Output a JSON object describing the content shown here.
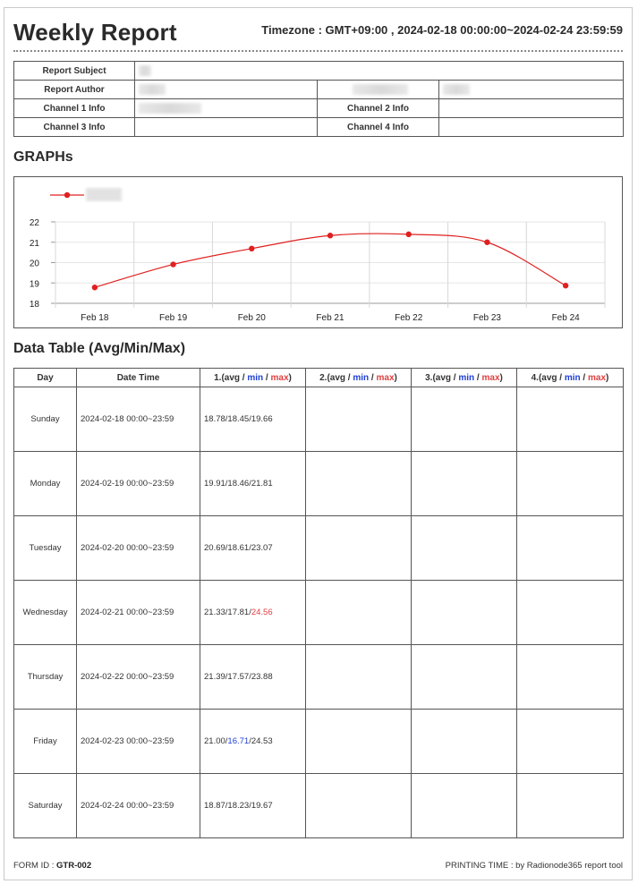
{
  "header": {
    "title": "Weekly Report",
    "timezone_text": "Timezone : GMT+09:00 , 2024-02-18 00:00:00~2024-02-24 23:59:59"
  },
  "info": {
    "report_subject_label": "Report Subject",
    "report_author_label": "Report Author",
    "channel1_label": "Channel 1 Info",
    "channel2_label": "Channel 2 Info",
    "channel3_label": "Channel 3 Info",
    "channel4_label": "Channel 4 Info"
  },
  "graph_section_title": "GRAPHs",
  "chart_data": {
    "type": "line",
    "categories": [
      "Feb 18",
      "Feb 19",
      "Feb 20",
      "Feb 21",
      "Feb 22",
      "Feb 23",
      "Feb 24"
    ],
    "series": [
      {
        "values": [
          18.78,
          19.91,
          20.69,
          21.33,
          21.39,
          21.0,
          18.87
        ],
        "color": "#e02020"
      }
    ],
    "yticks": [
      18,
      19,
      20,
      21,
      22
    ],
    "ylim": [
      18,
      22
    ],
    "grid": true,
    "legend_position": "top-left"
  },
  "table_section_title": "Data Table (Avg/Min/Max)",
  "table": {
    "headers": {
      "day": "Day",
      "datetime": "Date Time",
      "ch_prefix": [
        "1.(avg / ",
        "2.(avg / ",
        "3.(avg / ",
        "4.(avg / "
      ],
      "min": "min",
      "sep": " / ",
      "max": "max",
      "close": ")"
    },
    "rows": [
      {
        "day": "Sunday",
        "datetime": "2024-02-18 00:00~23:59",
        "avg": "18.78",
        "min": "18.45",
        "max": "19.66",
        "min_hl": false,
        "max_hl": false
      },
      {
        "day": "Monday",
        "datetime": "2024-02-19 00:00~23:59",
        "avg": "19.91",
        "min": "18.46",
        "max": "21.81",
        "min_hl": false,
        "max_hl": false
      },
      {
        "day": "Tuesday",
        "datetime": "2024-02-20 00:00~23:59",
        "avg": "20.69",
        "min": "18.61",
        "max": "23.07",
        "min_hl": false,
        "max_hl": false
      },
      {
        "day": "Wednesday",
        "datetime": "2024-02-21 00:00~23:59",
        "avg": "21.33",
        "min": "17.81",
        "max": "24.56",
        "min_hl": false,
        "max_hl": true
      },
      {
        "day": "Thursday",
        "datetime": "2024-02-22 00:00~23:59",
        "avg": "21.39",
        "min": "17.57",
        "max": "23.88",
        "min_hl": false,
        "max_hl": false
      },
      {
        "day": "Friday",
        "datetime": "2024-02-23 00:00~23:59",
        "avg": "21.00",
        "min": "16.71",
        "max": "24.53",
        "min_hl": true,
        "max_hl": false
      },
      {
        "day": "Saturday",
        "datetime": "2024-02-24 00:00~23:59",
        "avg": "18.87",
        "min": "18.23",
        "max": "19.67",
        "min_hl": false,
        "max_hl": false
      }
    ]
  },
  "footer": {
    "form_id_label": "FORM ID : ",
    "form_id_value": "GTR-002",
    "printing_text": "PRINTING TIME : by Radionode365 report tool"
  },
  "colors": {
    "min": "#1f3fd6",
    "max": "#e04040",
    "series": "#e02020"
  }
}
